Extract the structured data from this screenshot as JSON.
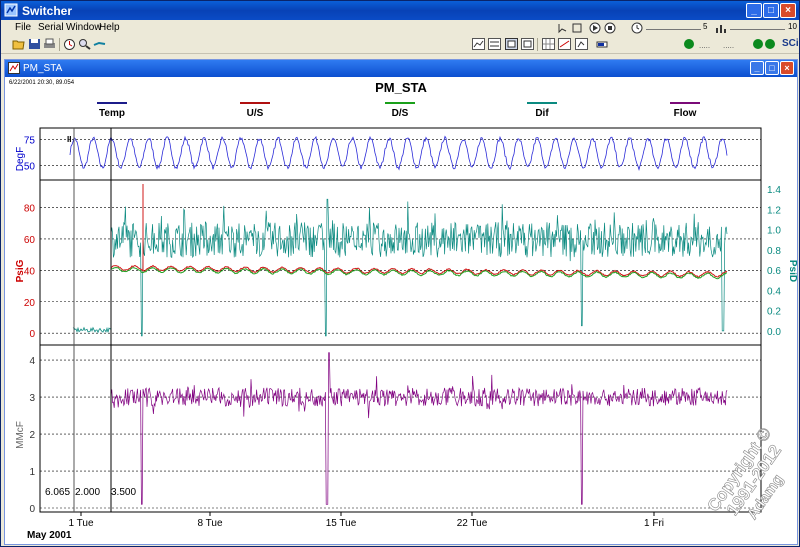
{
  "window": {
    "title": "Switcher",
    "menu": [
      "File",
      "Serial",
      "Window",
      "Help"
    ],
    "toolbar_right": {
      "slider_value": "5",
      "slider_max": "10",
      "sci_label": "SCi"
    }
  },
  "document": {
    "title": "PM_STA",
    "chart_title": "PM_STA",
    "timestamp": "6/22/2001 20:30, 89.054"
  },
  "legend": [
    {
      "name": "Temp",
      "color": "#1c1c8a"
    },
    {
      "name": "U/S",
      "color": "#b01010"
    },
    {
      "name": "D/S",
      "color": "#1aa01a"
    },
    {
      "name": "Dif",
      "color": "#0a8a80"
    },
    {
      "name": "Flow",
      "color": "#7a0a78"
    }
  ],
  "colors": {
    "temp": "#2a2ad8",
    "us": "#d01818",
    "ds": "#20a020",
    "dif": "#0a8a80",
    "flow": "#800080",
    "psig_axis": "#cc0000",
    "psid_axis": "#0a8a80",
    "degf_axis": "#0000cc"
  },
  "markers": {
    "left_values": [
      "6.065",
      "2.000",
      "3.500"
    ],
    "cursor_label": "II"
  },
  "watermark": {
    "line1": "Copyright ©",
    "line2": "1991-2012",
    "line3": "Adamg"
  },
  "chart_data": [
    {
      "type": "line",
      "ylabel": "DegF",
      "ylim": [
        40,
        82
      ],
      "yticks": [
        "75",
        "50"
      ],
      "series": [
        {
          "name": "Temp",
          "pattern": "daily cycle between ~48 and ~78"
        }
      ],
      "grid": true
    },
    {
      "type": "line",
      "ylabel": "PsiG",
      "ylabel_right": "PsiD",
      "ylim": [
        -5,
        95
      ],
      "ylim_right": [
        -0.1,
        1.45
      ],
      "yticks": [
        "0",
        "20",
        "40",
        "60",
        "80"
      ],
      "yticks_right": [
        "0.0",
        "0.2",
        "0.4",
        "0.6",
        "0.8",
        "1.0",
        "1.2",
        "1.4"
      ],
      "series": [
        {
          "name": "U/S",
          "level": 37
        },
        {
          "name": "D/S",
          "level": 36
        },
        {
          "name": "Dif",
          "level": 0.9
        }
      ],
      "grid": true
    },
    {
      "type": "line",
      "ylabel": "MMcF",
      "ylim": [
        0,
        4.3
      ],
      "yticks": [
        "0",
        "1",
        "2",
        "3",
        "4"
      ],
      "series": [
        {
          "name": "Flow",
          "level": 3.0
        }
      ],
      "grid": true
    }
  ],
  "x_axis": {
    "ticks": [
      "1 Tue",
      "8 Tue",
      "15 Tue",
      "22 Tue",
      "1 Fri"
    ],
    "month_label": "May 2001"
  }
}
